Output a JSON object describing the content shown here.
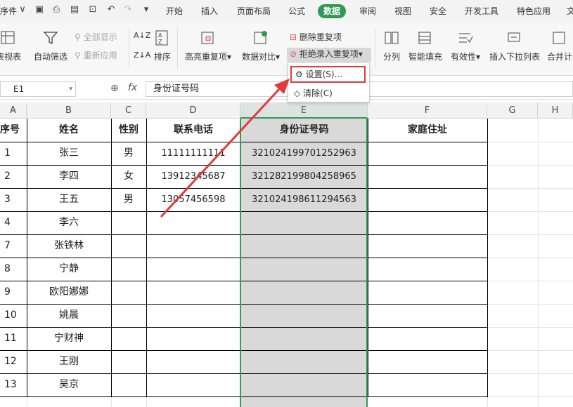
{
  "menubar": {
    "file_label": "序件",
    "tabs": [
      "开始",
      "插入",
      "页面布局",
      "公式",
      "数据",
      "审阅",
      "视图",
      "安全",
      "开发工具",
      "特色应用",
      "文"
    ],
    "active_tab": "数据"
  },
  "ribbon": {
    "pivot_label": "表视表",
    "autofilter_label": "自动筛选",
    "show_all_label": "全部显示",
    "reapply_label": "重新应用",
    "sort_label": "排序",
    "highlight_dup_label": "高亮重复项",
    "compare_label": "数据对比",
    "delete_dup_label": "删除重复项",
    "reject_dup_label": "拒绝录入重复项",
    "split_col_label": "分列",
    "smart_fill_label": "智能填充",
    "validity_label": "有效性",
    "insert_dropdown_label": "插入下拉列表",
    "merge_calc_label": "合并计"
  },
  "dropdown": {
    "items": [
      "设置(S)...",
      "清除(C)"
    ]
  },
  "formula_bar": {
    "cell_ref": "E1",
    "fx_label": "fx",
    "content": "身份证号码"
  },
  "columns": [
    "A",
    "B",
    "C",
    "D",
    "E",
    "F",
    "G",
    "H"
  ],
  "selected_column": "E",
  "table": {
    "headers": [
      "序号",
      "姓名",
      "性别",
      "联系电话",
      "身份证号码",
      "家庭住址"
    ],
    "rows": [
      [
        "1",
        "张三",
        "男",
        "11111111111",
        "321024199701252963",
        ""
      ],
      [
        "2",
        "李四",
        "女",
        "13912345687",
        "321282199804258965",
        ""
      ],
      [
        "3",
        "王五",
        "男",
        "13057456598",
        "321024198611294563",
        ""
      ],
      [
        "4",
        "李六",
        "",
        "",
        "",
        ""
      ],
      [
        "7",
        "张铁林",
        "",
        "",
        "",
        ""
      ],
      [
        "8",
        "宁静",
        "",
        "",
        "",
        ""
      ],
      [
        "9",
        "欧阳娜娜",
        "",
        "",
        "",
        ""
      ],
      [
        "10",
        "姚晨",
        "",
        "",
        "",
        ""
      ],
      [
        "11",
        "宁财神",
        "",
        "",
        "",
        ""
      ],
      [
        "12",
        "王刚",
        "",
        "",
        "",
        ""
      ],
      [
        "13",
        "吴京",
        "",
        "",
        "",
        ""
      ]
    ]
  },
  "colors": {
    "accent_green": "#2f9a53",
    "selection_fill": "#d9d9d9",
    "annotation_red": "#e03a3a"
  }
}
